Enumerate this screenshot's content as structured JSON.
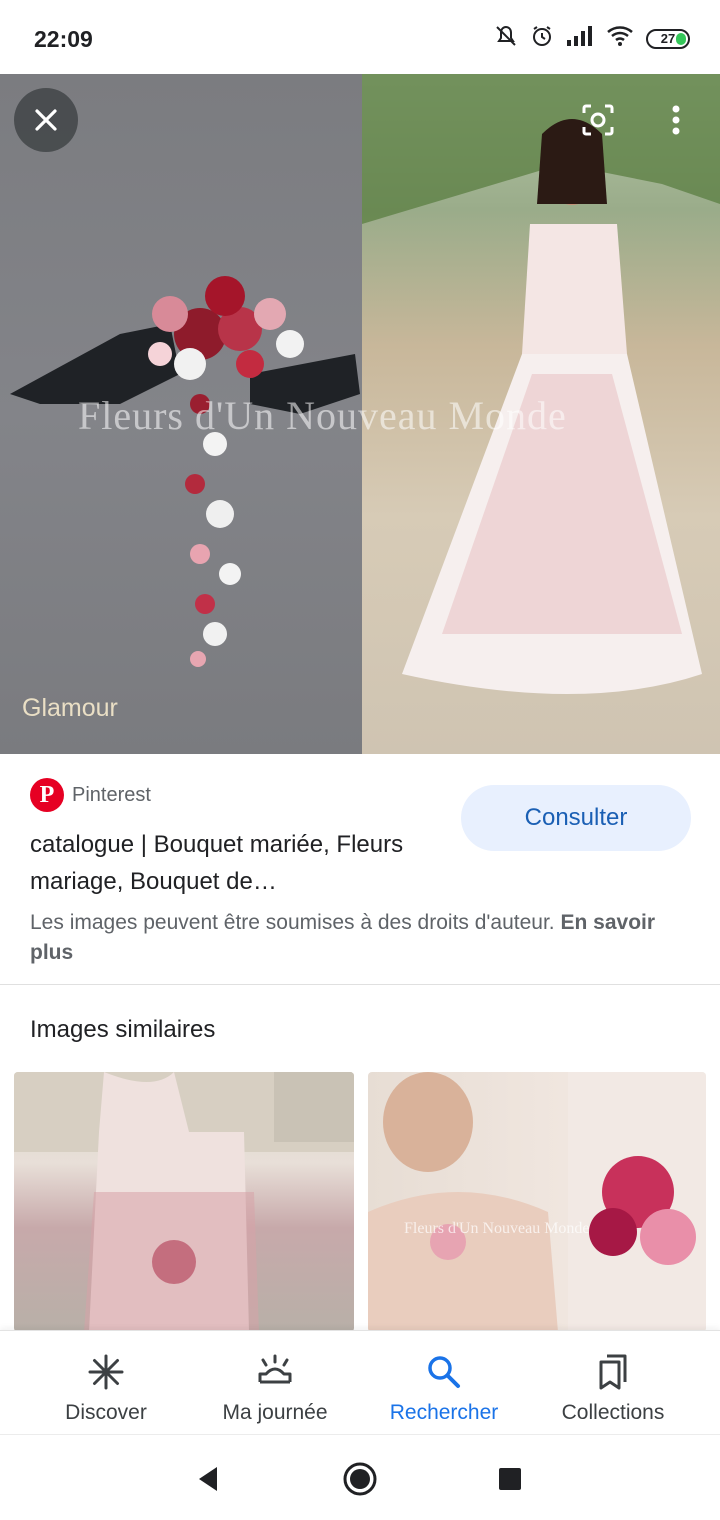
{
  "status_bar": {
    "time": "22:09",
    "battery": "27",
    "icons": [
      "mute-icon",
      "alarm-icon",
      "signal-icon",
      "wifi-icon",
      "battery-icon"
    ]
  },
  "hero": {
    "watermark": "Fleurs d'Un Nouveau Monde",
    "caption": "Glamour"
  },
  "source": {
    "site": "Pinterest",
    "title": "catalogue | Bouquet mariée, Fleurs mariage, Bouquet de…",
    "action": "Consulter"
  },
  "copyright": {
    "text": "Les images peuvent être soumises à des droits d'auteur.",
    "link": "En savoir plus"
  },
  "similar": {
    "title": "Images similaires",
    "thumb_watermark": "Fleurs d'Un Nouveau Monde"
  },
  "bottom_nav": {
    "items": [
      {
        "label": "Discover",
        "icon": "asterisk-icon"
      },
      {
        "label": "Ma journée",
        "icon": "sunrise-icon"
      },
      {
        "label": "Rechercher",
        "icon": "search-icon"
      },
      {
        "label": "Collections",
        "icon": "bookmarks-icon"
      }
    ],
    "active_index": 2,
    "active_color": "#1a73e8"
  },
  "system_nav": [
    "back-icon",
    "home-icon",
    "recents-icon"
  ]
}
